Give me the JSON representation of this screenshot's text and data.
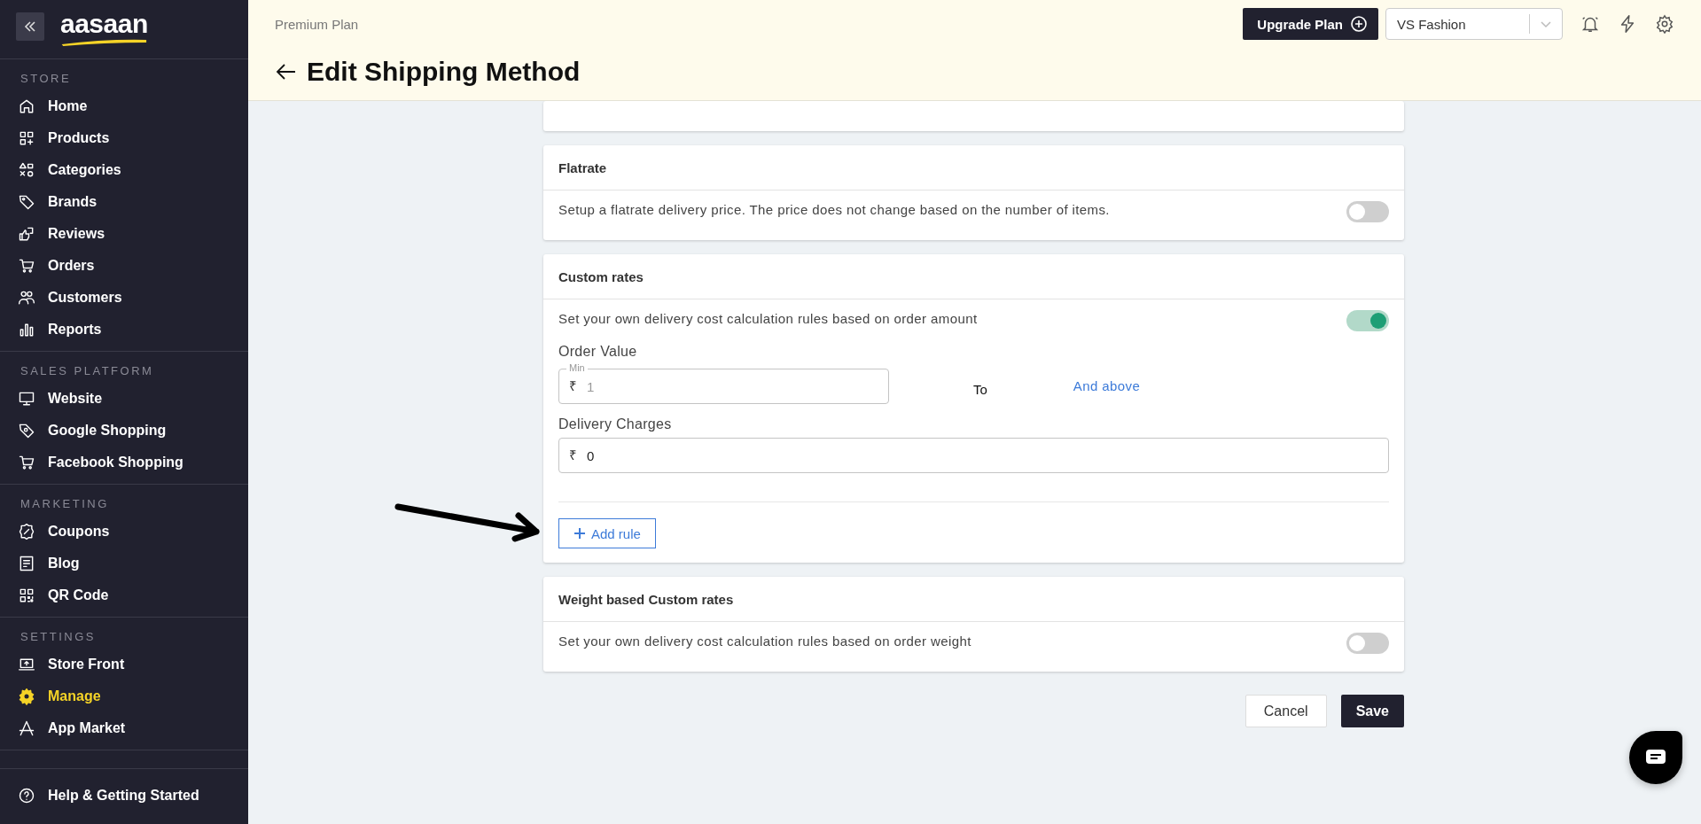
{
  "sidebar": {
    "logo": "aasaan",
    "sections": [
      {
        "title": "STORE",
        "items": [
          {
            "label": "Home",
            "selected": false
          },
          {
            "label": "Products",
            "selected": false
          },
          {
            "label": "Categories",
            "selected": false
          },
          {
            "label": "Brands",
            "selected": false
          },
          {
            "label": "Reviews",
            "selected": false
          },
          {
            "label": "Orders",
            "selected": false
          },
          {
            "label": "Customers",
            "selected": false
          },
          {
            "label": "Reports",
            "selected": false
          }
        ]
      },
      {
        "title": "SALES PLATFORM",
        "items": [
          {
            "label": "Website",
            "selected": false
          },
          {
            "label": "Google Shopping",
            "selected": false
          },
          {
            "label": "Facebook Shopping",
            "selected": false
          }
        ]
      },
      {
        "title": "MARKETING",
        "items": [
          {
            "label": "Coupons",
            "selected": false
          },
          {
            "label": "Blog",
            "selected": false
          },
          {
            "label": "QR Code",
            "selected": false
          }
        ]
      },
      {
        "title": "SETTINGS",
        "items": [
          {
            "label": "Store Front",
            "selected": false
          },
          {
            "label": "Manage",
            "selected": true
          },
          {
            "label": "App Market",
            "selected": false
          }
        ]
      }
    ],
    "footer_item": {
      "label": "Help & Getting Started"
    }
  },
  "header": {
    "plan": "Premium Plan",
    "title": "Edit Shipping Method",
    "upgrade_button": "Upgrade Plan",
    "store_select": {
      "value": "VS Fashion"
    }
  },
  "methods": [
    {
      "kind": "simple",
      "title": "Flatrate",
      "description": "Setup a flatrate delivery price. The price does not change based on the number of items.",
      "on": false
    },
    {
      "kind": "rules",
      "title": "Custom rates",
      "description": "Set your own delivery cost calculation rules based on order amount",
      "on": true,
      "order_value_label": "Order Value",
      "min_field": {
        "label": "Min",
        "currency": "₹",
        "placeholder": "1"
      },
      "to_label": "To",
      "max_text": "And above",
      "delivery_label": "Delivery Charges",
      "delivery_field": {
        "currency": "₹",
        "value": "0"
      },
      "add_rule_button": "Add rule"
    },
    {
      "kind": "simple",
      "title": "Weight based Custom rates",
      "description": "Set your own delivery cost calculation rules based on order weight",
      "on": false
    }
  ],
  "actions": {
    "cancel": "Cancel",
    "save": "Save"
  }
}
